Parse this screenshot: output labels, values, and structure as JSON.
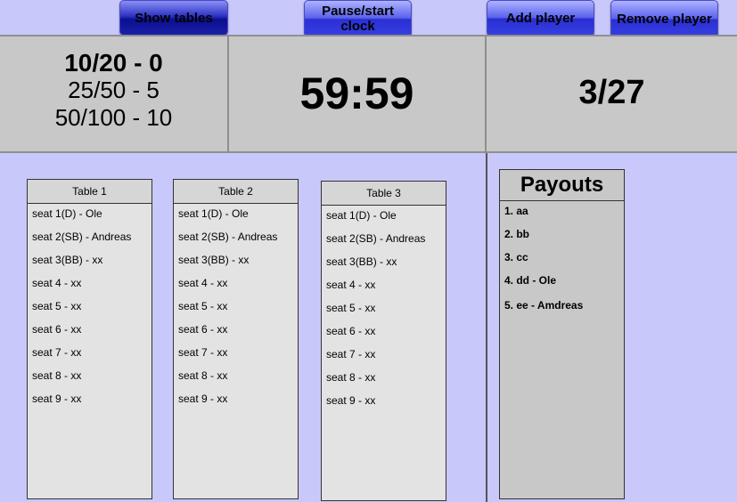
{
  "toolbar": {
    "show_tables": "Show tables",
    "pause_start": "Pause/start clock",
    "add_player": "Add player",
    "remove_player": "Remove player"
  },
  "blinds": {
    "current": "10/20 - 0",
    "next": "25/50 - 5",
    "after": "50/100 - 10"
  },
  "clock": "59:59",
  "players": "3/27",
  "tables": [
    {
      "title": "Table 1",
      "seats": [
        "seat 1(D) - Ole",
        "seat 2(SB) - Andreas",
        "seat 3(BB) - xx",
        "seat 4 - xx",
        "seat 5 - xx",
        "seat 6 - xx",
        "seat 7 - xx",
        "seat 8 - xx",
        "seat 9 - xx"
      ]
    },
    {
      "title": "Table 2",
      "seats": [
        "seat 1(D) - Ole",
        "seat 2(SB) - Andreas",
        "seat 3(BB) - xx",
        "seat 4 - xx",
        "seat 5 - xx",
        "seat 6 - xx",
        "seat 7 - xx",
        "seat 8 - xx",
        "seat 9 - xx"
      ]
    },
    {
      "title": "Table 3",
      "seats": [
        "seat 1(D) - Ole",
        "seat 2(SB) - Andreas",
        "seat 3(BB) - xx",
        "seat 4 - xx",
        "seat 5 - xx",
        "seat 6 - xx",
        "seat 7 - xx",
        "seat 8 - xx",
        "seat 9 - xx"
      ]
    }
  ],
  "payouts": {
    "title": "Payouts",
    "items": [
      "1. aa",
      "2. bb",
      "3. cc",
      "4. dd - Ole",
      "5. ee - Amdreas"
    ]
  },
  "colors": {
    "background": "#c9c8fb",
    "panel": "#c8c8c8",
    "table_bg": "#e3e3e3",
    "button_blue": "#3740e2"
  }
}
